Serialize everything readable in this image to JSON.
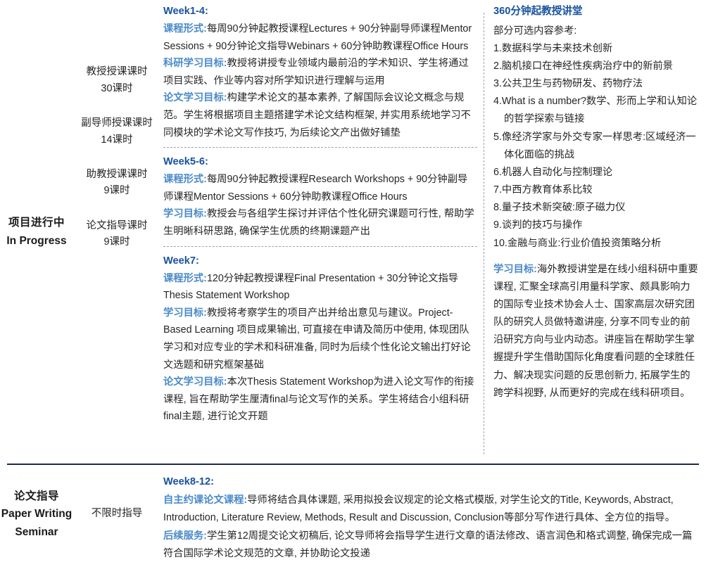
{
  "colors": {
    "heading_blue": "#17529e",
    "label_blue": "#4a8ac9",
    "body": "#262626",
    "rule_navy": "#1a2a4a",
    "dash_gray": "#9aa3ad"
  },
  "rows": [
    {
      "stage_cn": "项目进行中",
      "stage_en": "In Progress",
      "hours": [
        {
          "name": "教授授课课时",
          "value": "30课时"
        },
        {
          "name": "副导师授课课时",
          "value": "14课时"
        },
        {
          "name": "助教授课课时",
          "value": "9课时"
        },
        {
          "name": "论文指导课时",
          "value": "9课时"
        }
      ],
      "blocks": [
        {
          "week": "Week1-4:",
          "items": [
            {
              "label": "课程形式:",
              "text": "每周90分钟起教授课程Lectures + 90分钟副导师课程Mentor Sessions + 90分钟论文指导Webinars + 60分钟助教课程Office Hours"
            },
            {
              "label": "科研学习目标:",
              "text": "教授将讲授专业领域内最前沿的学术知识、学生将通过项目实践、作业等内容对所学知识进行理解与运用"
            },
            {
              "label": "论文学习目标:",
              "text": "构建学术论文的基本素养, 了解国际会议论文概念与规范。学生将根据项目主题搭建学术论文结构框架, 并实用系统地学习不同模块的学术论文写作技巧, 为后续论文产出做好铺垫"
            }
          ]
        },
        {
          "week": "Week5-6:",
          "items": [
            {
              "label": "课程形式:",
              "text": "每周90分钟起教授课程Research Workshops + 90分钟副导师课程Mentor Sessions + 60分钟助教课程Office Hours"
            },
            {
              "label": "学习目标:",
              "text": "教授会与各组学生探讨并评估个性化研究课题可行性, 帮助学生明晰科研思路, 确保学生优质的终期课题产出"
            }
          ]
        },
        {
          "week": "Week7:",
          "items": [
            {
              "label": "课程形式:",
              "text": "120分钟起教授课程Final Presentation + 30分钟论文指导Thesis Statement Workshop"
            },
            {
              "label": "学习目标:",
              "text": "教授将考察学生的项目产出并给出意见与建议。Project-Based Learning 项目成果输出, 可直接在申请及简历中使用, 体现团队学习和对应专业的学术和科研准备, 同时为后续个性化论文输出打好论文选题和研究框架基础"
            },
            {
              "label": "论文学习目标:",
              "text": "本次Thesis Statement Workshop为进入论文写作的衔接课程, 旨在帮助学生厘清final与论文写作的关系。学生将结合小组科研final主题, 进行论文开题"
            }
          ]
        }
      ],
      "aside": {
        "heading": "360分钟起教授讲堂",
        "intro": "部分可选内容参考:",
        "topics": [
          "1.数据科学与未来技术创新",
          "2.脑机接口在神经性疾病治疗中的新前景",
          "3.公共卫生与药物研发、药物疗法",
          "4.What is a number?数学、形而上学和认知论的哲学探索与链接",
          "5.像经济学家与外交专家一样思考:区域经济一体化面临的挑战",
          "6.机器人自动化与控制理论",
          "7.中西方教育体系比较",
          "8.量子技术新突破:原子磁力仪",
          "9.谈判的技巧与操作",
          "10.金融与商业:行业价值投资策略分析"
        ],
        "goal_label": "学习目标:",
        "goal_text": "海外教授讲堂是在线小组科研中重要课程, 汇聚全球高引用量科学家、颇具影响力的国际专业技术协会人士、国家高层次研究团队的研究人员做特邀讲座, 分享不同专业的前沿研究方向与业内动态。讲座旨在帮助学生掌握提升学生借助国际化角度看问题的全球胜任力、解决现实问题的反思创新力, 拓展学生的跨学科视野, 从而更好的完成在线科研项目。"
      }
    },
    {
      "stage_cn": "论文指导",
      "stage_en_line1": "Paper Writing",
      "stage_en_line2": "Seminar",
      "hours_note": "不限时指导",
      "week": "Week8-12:",
      "items": [
        {
          "label": "自主约课论文课程:",
          "text": "导师将结合具体课题, 采用拟投会议规定的论文格式模版, 对学生论文的Title, Keywords, Abstract, Introduction, Literature Review, Methods, Result and Discussion, Conclusion等部分写作进行具体、全方位的指导。"
        },
        {
          "label": "后续服务:",
          "text": "学生第12周提交论文初稿后, 论文导师将会指导学生进行文章的语法修改、语言润色和格式调整, 确保完成一篇符合国际学术论文规范的文章, 并协助论文投递"
        }
      ]
    }
  ]
}
